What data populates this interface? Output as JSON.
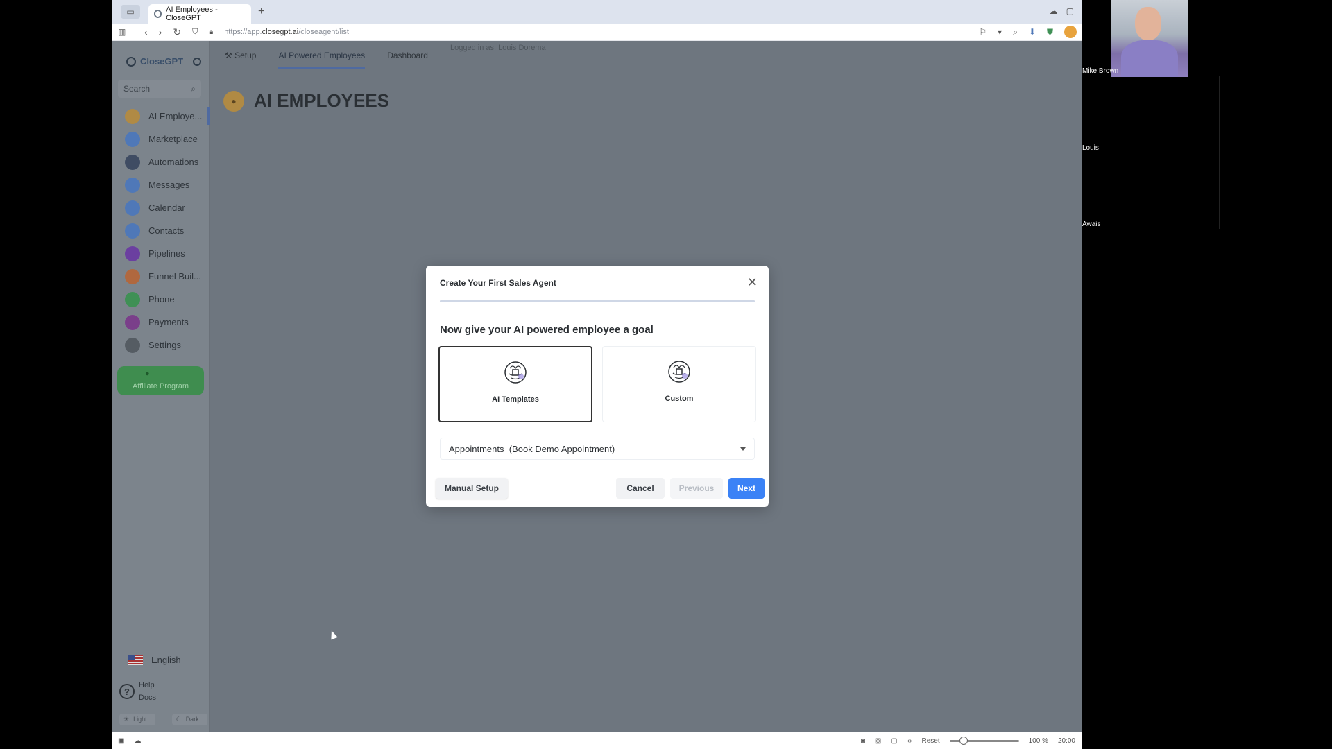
{
  "browser": {
    "tab_title": "AI Employees - CloseGPT",
    "new_tab": "+",
    "url_prefix": "https://app.",
    "url_domain": "closegpt.ai",
    "url_path": "/closeagent/list"
  },
  "app": {
    "logo": "CloseGPT",
    "search_placeholder": "Search",
    "sidebar": {
      "items": [
        {
          "label": "AI Employe...",
          "icon": "lightbulb-icon",
          "color": "#b08a44"
        },
        {
          "label": "Marketplace",
          "icon": "store-icon",
          "color": "#4f78b8"
        },
        {
          "label": "Automations",
          "icon": "automation-icon",
          "color": "#3f4c63"
        },
        {
          "label": "Messages",
          "icon": "message-icon",
          "color": "#4f78b8"
        },
        {
          "label": "Calendar",
          "icon": "calendar-icon",
          "color": "#4f78b8"
        },
        {
          "label": "Contacts",
          "icon": "contacts-icon",
          "color": "#4f78b8"
        },
        {
          "label": "Pipelines",
          "icon": "dollar-icon",
          "color": "#6b3fa0"
        },
        {
          "label": "Funnel Buil...",
          "icon": "funnel-icon",
          "color": "#b0683f"
        },
        {
          "label": "Phone",
          "icon": "phone-icon",
          "color": "#3f9055"
        },
        {
          "label": "Payments",
          "icon": "card-icon",
          "color": "#7a3f8a"
        },
        {
          "label": "Settings",
          "icon": "gear-icon",
          "color": "#555c63"
        }
      ],
      "affiliate": "Affiliate Program",
      "language": "English",
      "help": "Help",
      "docs": "Docs",
      "light": "Light",
      "dark": "Dark"
    },
    "topnav": {
      "setup": "Setup",
      "ai_powered": "AI Powered Employees",
      "dashboard": "Dashboard"
    },
    "logged_in": "Logged in as: Louis Dorema",
    "page_title": "AI EMPLOYEES"
  },
  "modal": {
    "title": "Create Your First Sales Agent",
    "close": "✕",
    "goal": "Now give your AI powered employee a goal",
    "choices": [
      {
        "label": "AI Templates",
        "selected": true
      },
      {
        "label": "Custom",
        "selected": false
      }
    ],
    "select_value": "Appointments  (Book Demo Appointment)",
    "buttons": {
      "manual": "Manual Setup",
      "cancel": "Cancel",
      "previous": "Previous",
      "next": "Next"
    },
    "progress": 1.0
  },
  "statusbar": {
    "reset": "Reset",
    "zoom": "100 %",
    "time": "20:00"
  },
  "participants": [
    {
      "name": "Mike Brown"
    },
    {
      "name": "Louis"
    },
    {
      "name": "Awais"
    }
  ]
}
